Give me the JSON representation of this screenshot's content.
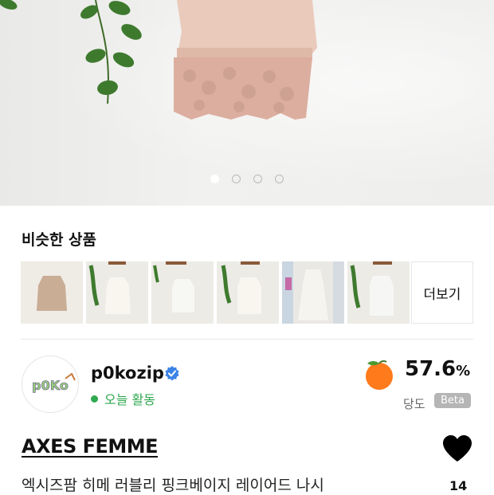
{
  "hero": {
    "image_alt": "",
    "carousel": {
      "count": 4,
      "active_index": 0
    }
  },
  "similar": {
    "title": "비슷한 상품",
    "more_label": "더보기",
    "thumbnails": [
      {
        "icon": "beige-knit-top-image"
      },
      {
        "icon": "white-sleeveless-top-image"
      },
      {
        "icon": "white-sleeveless-top-image"
      },
      {
        "icon": "white-sleeveless-top-image"
      },
      {
        "icon": "white-lace-dress-image"
      },
      {
        "icon": "white-sleeveless-top-image"
      }
    ]
  },
  "seller": {
    "avatar_text": "p0Ko",
    "name": "p0kozip",
    "verified": true,
    "status": "오늘 활동",
    "status_color": "#2fa84f"
  },
  "dangdo": {
    "value": "57.6",
    "unit": "%",
    "label": "당도",
    "badge": "Beta",
    "icon": "peach-icon"
  },
  "product": {
    "brand": "AXES FEMME",
    "name": "엑시즈팜 히메 러블리 핑크베이지 레이어드 나시",
    "likes": "14",
    "icon": "heart-icon"
  }
}
